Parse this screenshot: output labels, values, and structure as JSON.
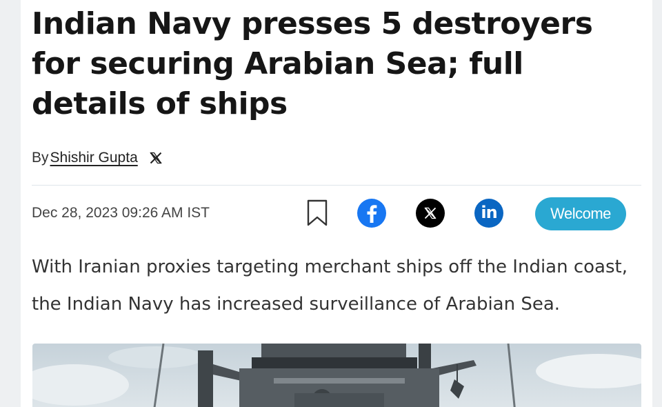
{
  "article": {
    "headline": "Indian Navy presses 5 destroyers for securing Arabian Sea; full details of ships",
    "byline_prefix": "By",
    "author": "Shishir Gupta",
    "date": "Dec 28, 2023 09:26 AM IST",
    "summary": "With Iranian proxies targeting merchant ships off the Indian coast, the Indian Navy has increased surveillance of Arabian Sea."
  },
  "share": {
    "bookmark_icon": "bookmark-icon",
    "facebook_icon": "facebook-icon",
    "x_icon": "x-icon",
    "linkedin_icon": "linkedin-icon",
    "linkedin_label": "in",
    "welcome_label": "Welcome"
  },
  "colors": {
    "facebook": "#1877f2",
    "linkedin": "#0a66c2",
    "welcome": "#2aa8d2"
  }
}
